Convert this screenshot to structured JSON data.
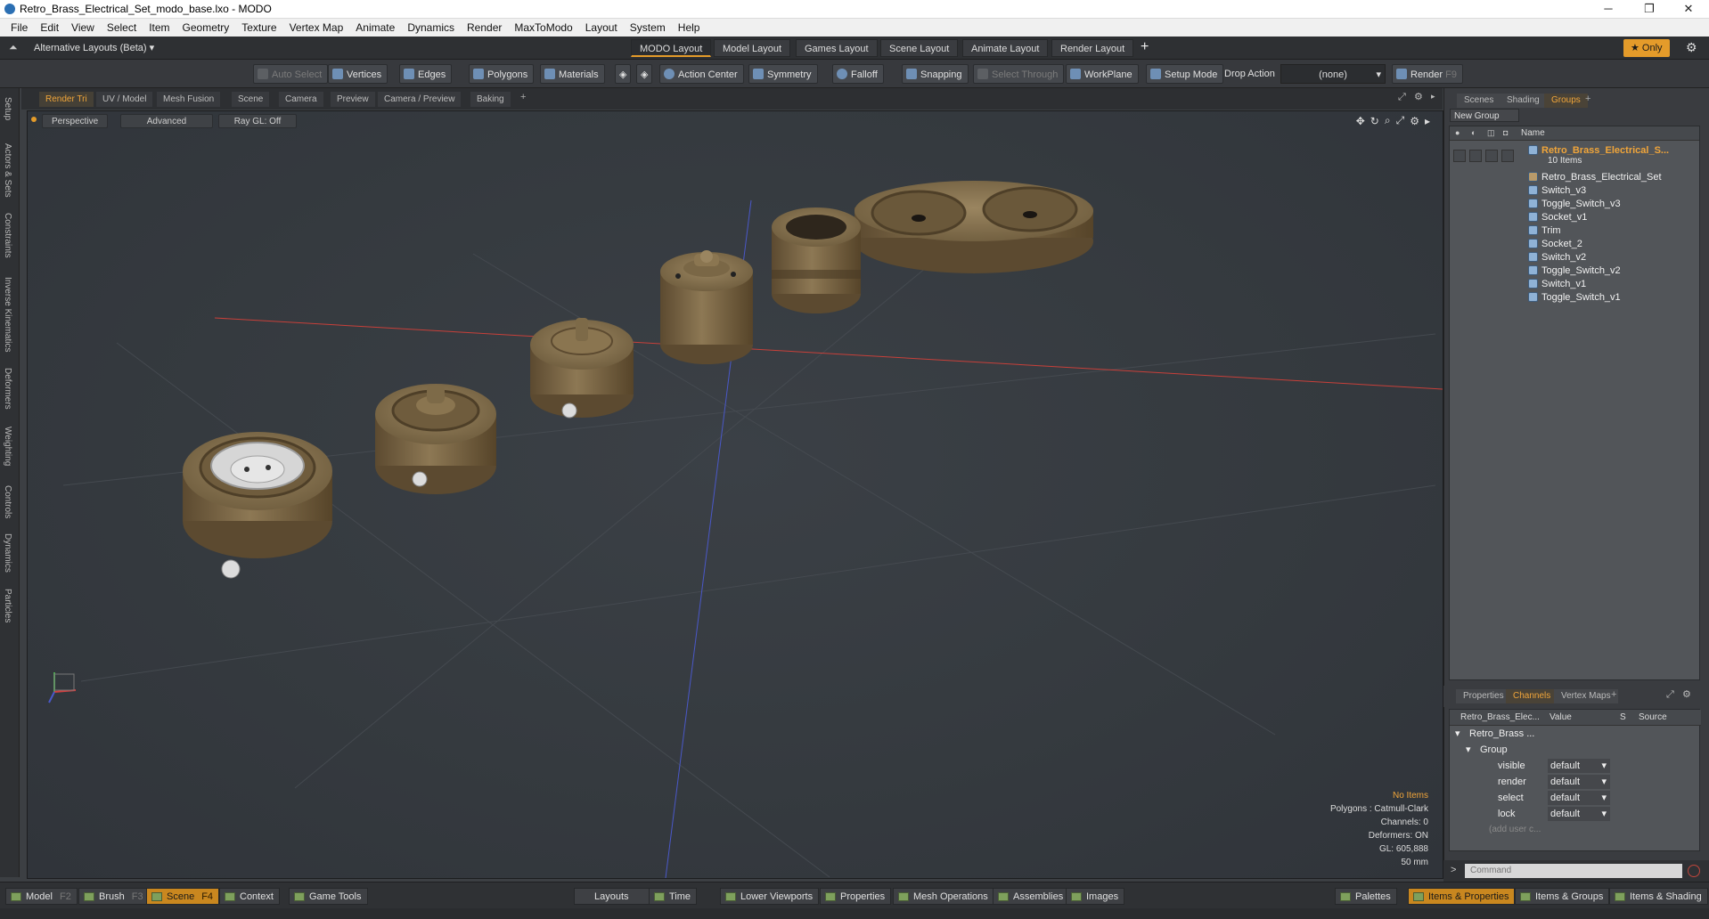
{
  "window": {
    "title": "Retro_Brass_Electrical_Set_modo_base.lxo - MODO",
    "minimize": "─",
    "maximize": "❐",
    "close": "✕"
  },
  "menu": [
    "File",
    "Edit",
    "View",
    "Select",
    "Item",
    "Geometry",
    "Texture",
    "Vertex Map",
    "Animate",
    "Dynamics",
    "Render",
    "MaxToModo",
    "Layout",
    "System",
    "Help"
  ],
  "layouts": {
    "switcher": "Alternative Layouts (Beta) ▾",
    "tabs": [
      "MODO Layout",
      "Model Layout",
      "Games Layout",
      "Scene Layout",
      "Animate Layout",
      "Render Layout"
    ],
    "active": "MODO Layout",
    "add": "+",
    "only": "★ Only"
  },
  "toolbar": {
    "auto_select": "Auto Select",
    "vertices": "Vertices",
    "edges": "Edges",
    "polygons": "Polygons",
    "materials": "Materials",
    "action_center": "Action Center",
    "symmetry": "Symmetry",
    "falloff": "Falloff",
    "snapping": "Snapping",
    "select_through": "Select Through",
    "workplane": "WorkPlane",
    "setup_mode": "Setup Mode",
    "drop_action_label": "Drop Action",
    "drop_action_value": "(none)",
    "render": "Render",
    "render_key": "F9"
  },
  "left_tabs": [
    "Setup",
    "Actors & Sets",
    "Constraints",
    "Inverse Kinematics",
    "Deformers",
    "Weighting",
    "Controls",
    "Dynamics",
    "Particles"
  ],
  "viewport_tabs": [
    "Render Tri",
    "UV / Model",
    "Mesh Fusion",
    "Scene",
    "Camera",
    "Preview",
    "Camera / Preview",
    "Baking"
  ],
  "viewport": {
    "view": "Perspective",
    "shading": "Advanced",
    "raygl": "Ray GL: Off",
    "stats": {
      "items": "No Items",
      "polygons": "Polygons : Catmull-Clark",
      "channels": "Channels: 0",
      "deformers": "Deformers: ON",
      "gl": "GL: 605,888",
      "unit": "50 mm"
    }
  },
  "scene_panel": {
    "tabs": [
      "Scenes",
      "Shading",
      "Groups"
    ],
    "active": "Groups",
    "new_group": "New Group",
    "name_header": "Name",
    "group_name": "Retro_Brass_Electrical_S...",
    "group_count": "10 Items",
    "items": [
      "Retro_Brass_Electrical_Set",
      "Switch_v3",
      "Toggle_Switch_v3",
      "Socket_v1",
      "Trim",
      "Socket_2",
      "Switch_v2",
      "Toggle_Switch_v2",
      "Switch_v1",
      "Toggle_Switch_v1"
    ]
  },
  "properties_panel": {
    "tabs": [
      "Properties",
      "Channels",
      "Vertex Maps"
    ],
    "active": "Channels",
    "headers": {
      "name": "Retro_Brass_Elec...",
      "value": "Value",
      "s": "S",
      "source": "Source"
    },
    "root": "Retro_Brass ...",
    "group": "Group",
    "channels": [
      {
        "name": "visible",
        "value": "default"
      },
      {
        "name": "render",
        "value": "default"
      },
      {
        "name": "select",
        "value": "default"
      },
      {
        "name": "lock",
        "value": "default"
      }
    ],
    "add_user": "(add user c..."
  },
  "command": {
    "prompt": ">",
    "placeholder": "Command"
  },
  "bottom": {
    "model": "Model",
    "model_key": "F2",
    "brush": "Brush",
    "brush_key": "F3",
    "scene": "Scene",
    "scene_key": "F4",
    "context": "Context",
    "game_tools": "Game Tools",
    "layouts": "Layouts",
    "time": "Time",
    "lower_viewports": "Lower Viewports",
    "properties": "Properties",
    "mesh_operations": "Mesh Operations",
    "assemblies": "Assemblies",
    "images": "Images",
    "palettes": "Palettes",
    "items_properties": "Items & Properties",
    "items_groups": "Items & Groups",
    "items_shading": "Items & Shading"
  },
  "colors": {
    "accent": "#e49b2a",
    "wood": "#8a7550",
    "wood_dark": "#5c4a30",
    "axis_x": "#c8403a",
    "axis_z": "#4a58c8"
  }
}
